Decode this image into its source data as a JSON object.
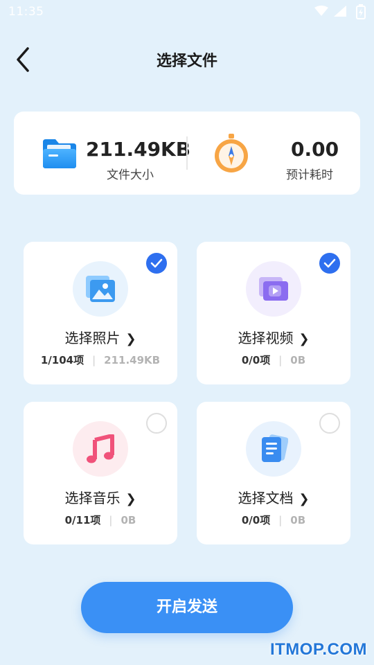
{
  "status_bar": {
    "time": "11:35"
  },
  "header": {
    "title": "选择文件"
  },
  "summary": {
    "size_value": "211.49KB",
    "size_label": "文件大小",
    "time_value": "0.00",
    "time_label": "预计耗时"
  },
  "categories": [
    {
      "title": "选择照片",
      "count": "1/104项",
      "size": "211.49KB",
      "selected": true,
      "icon": "photo-icon"
    },
    {
      "title": "选择视频",
      "count": "0/0项",
      "size": "0B",
      "selected": true,
      "icon": "video-icon"
    },
    {
      "title": "选择音乐",
      "count": "0/11项",
      "size": "0B",
      "selected": false,
      "icon": "music-icon"
    },
    {
      "title": "选择文档",
      "count": "0/0项",
      "size": "0B",
      "selected": false,
      "icon": "document-icon"
    }
  ],
  "actions": {
    "send_label": "开启发送"
  },
  "watermark": "ITMOP.COM",
  "colors": {
    "background": "#e3f1fb",
    "accent": "#3a90f5",
    "check": "#2e6fef"
  }
}
